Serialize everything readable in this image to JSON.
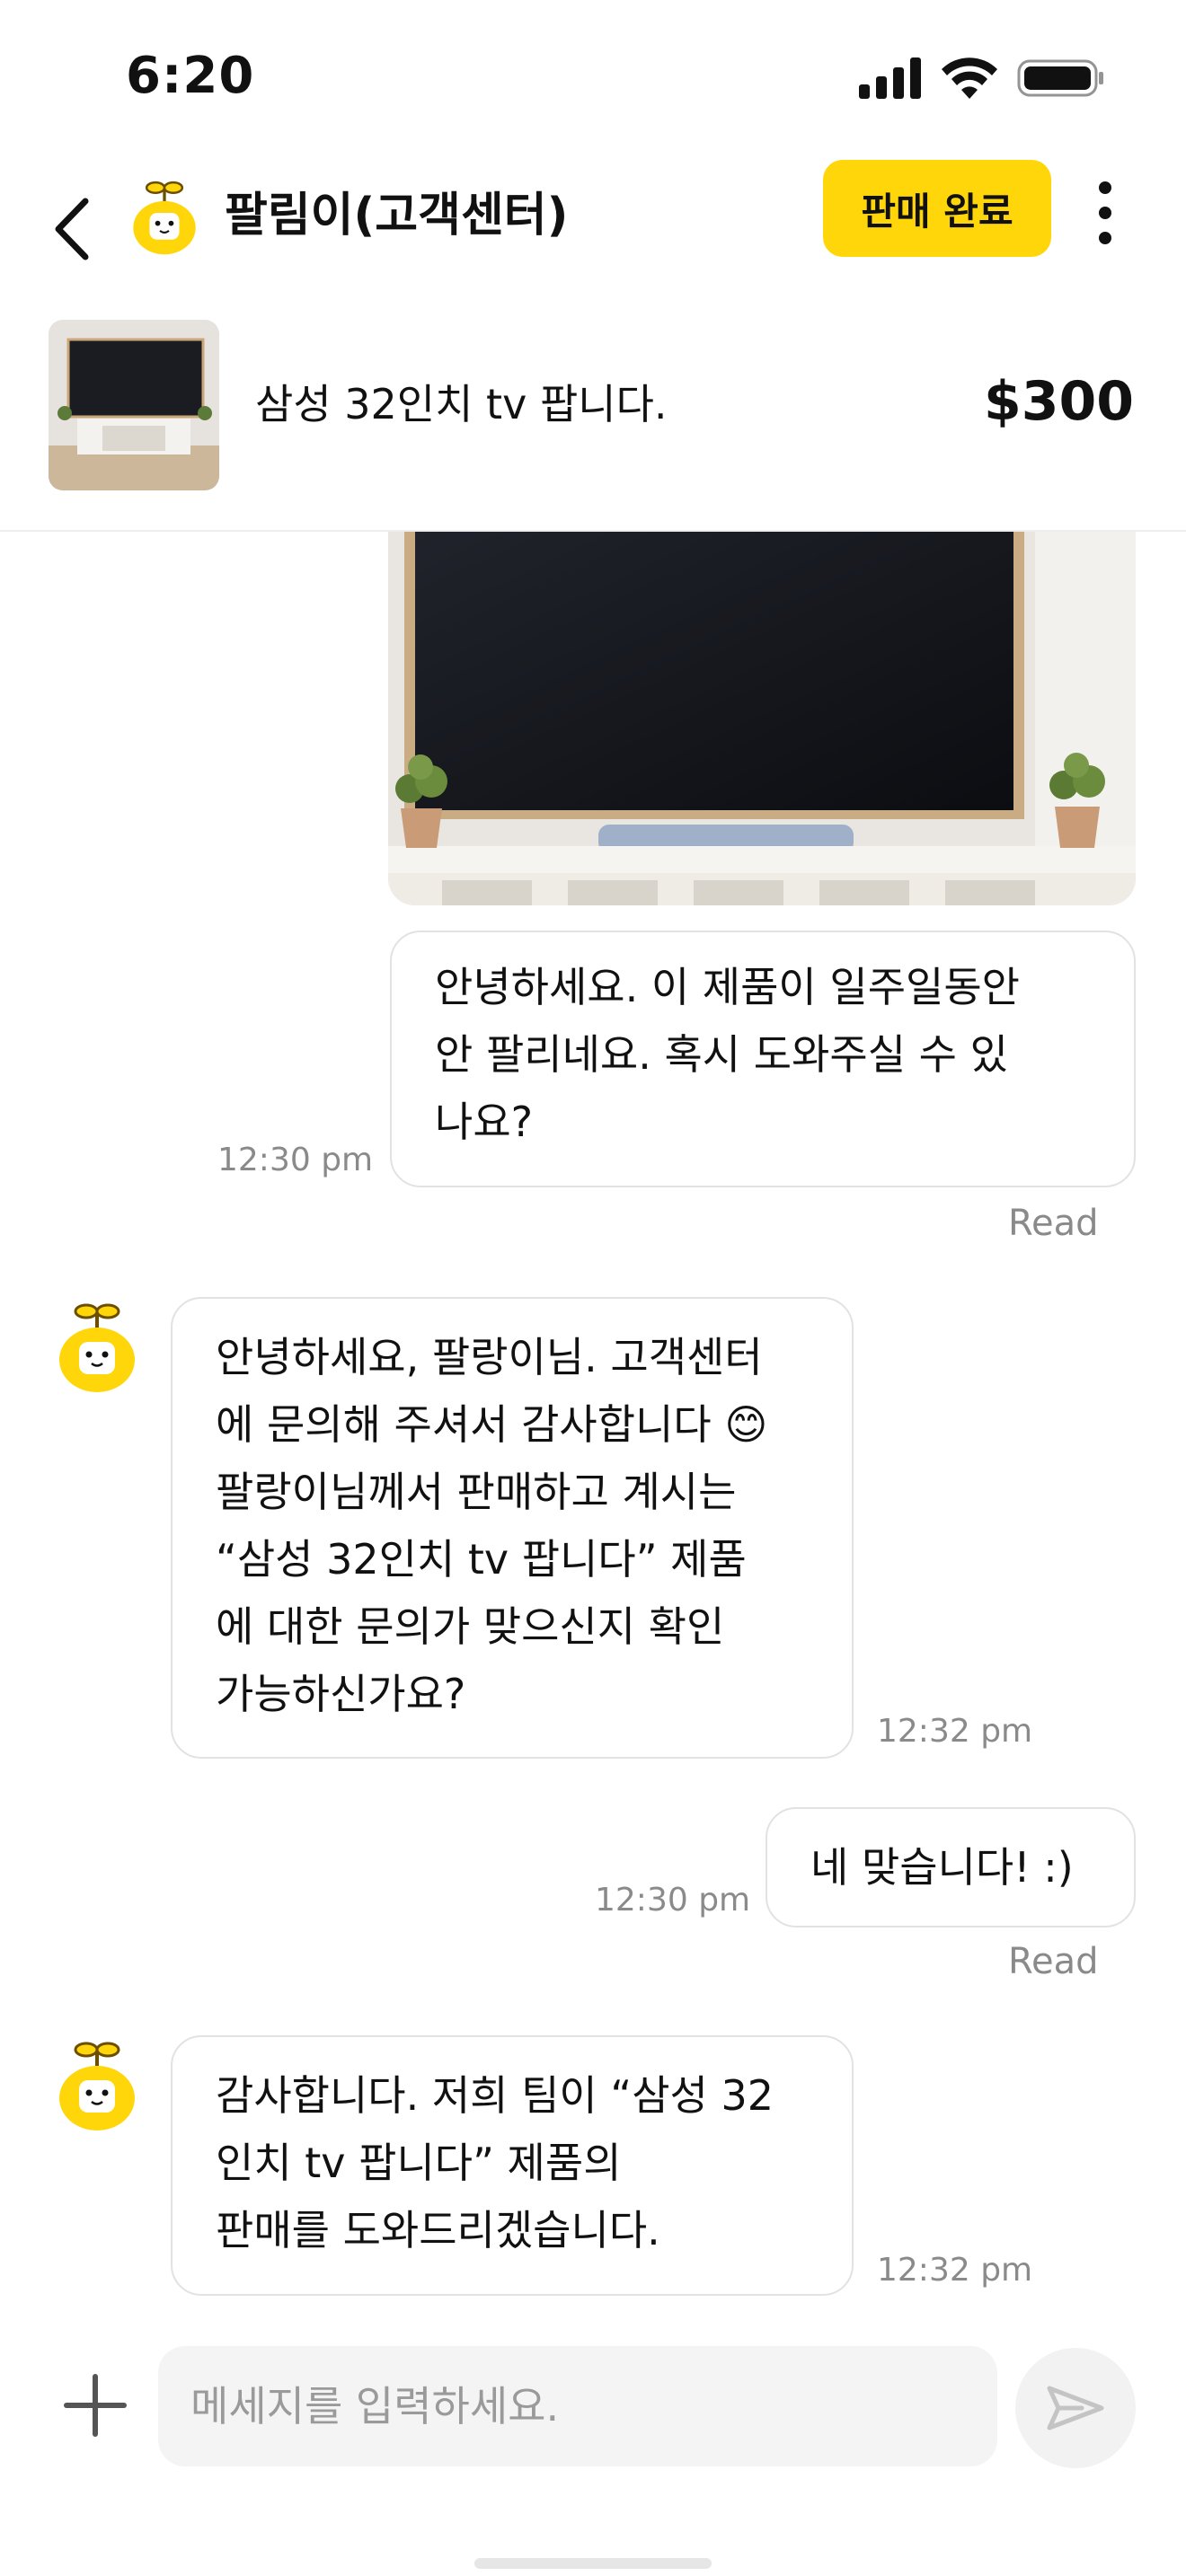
{
  "status_bar": {
    "time": "6:20"
  },
  "header": {
    "title": "팔림이(고객센터)",
    "sold_label": "판매 완료"
  },
  "product": {
    "title": "삼성 32인치 tv 팝니다.",
    "price": "$300"
  },
  "messages": [
    {
      "sender": "me",
      "lines": [
        "안녕하세요. 이 제품이 일주일동안",
        "안 팔리네요. 혹시 도와주실 수 있",
        "나요?"
      ],
      "time": "12:30 pm",
      "status": "Read"
    },
    {
      "sender": "bot",
      "lines": [
        "안녕하세요, 팔랑이님. 고객센터",
        "에 문의해 주셔서 감사합니다 😊",
        "팔랑이님께서 판매하고 계시는",
        "“삼성 32인치 tv 팝니다” 제품",
        "에 대한 문의가 맞으신지 확인",
        "가능하신가요?"
      ],
      "time": "12:32 pm"
    },
    {
      "sender": "me",
      "lines": [
        "네 맞습니다! :)"
      ],
      "time": "12:30 pm",
      "status": "Read"
    },
    {
      "sender": "bot",
      "lines": [
        "감사합니다. 저희 팀이 “삼성 32",
        "인치 tv 팝니다” 제품의",
        "판매를 도와드리겠습니다."
      ],
      "time": "12:32 pm"
    }
  ],
  "composer": {
    "placeholder": "메세지를 입력하세요."
  },
  "colors": {
    "accent": "#FFD60A",
    "bubble_border": "#E2E2E2",
    "muted_text": "#8A8A8A"
  },
  "icons": [
    "back-chevron-icon",
    "mascot-avatar-icon",
    "more-vertical-icon",
    "plus-icon",
    "send-icon",
    "signal-icon",
    "wifi-icon",
    "battery-icon"
  ]
}
